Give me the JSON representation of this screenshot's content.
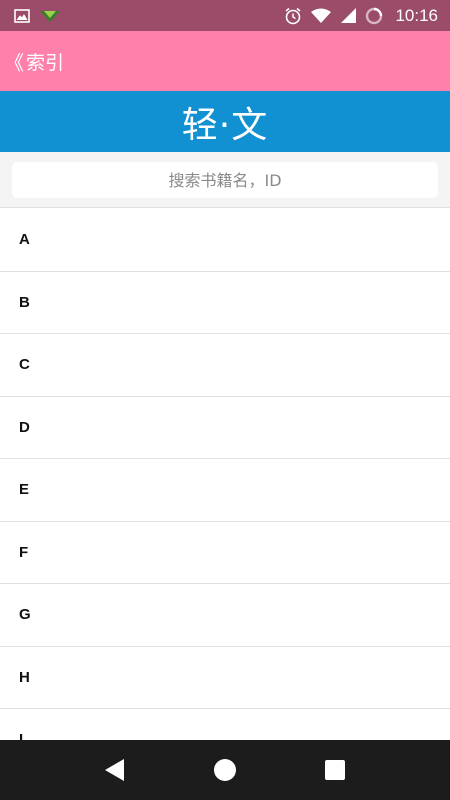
{
  "status_bar": {
    "time": "10:16",
    "icons": [
      "image-icon",
      "download-icon",
      "alarm-icon",
      "wifi-icon",
      "signal-icon",
      "loading-icon"
    ]
  },
  "top_bar": {
    "back_chevron": "《",
    "back_label": "索引"
  },
  "banner": {
    "title": "轻·文"
  },
  "search": {
    "placeholder": "搜索书籍名，ID"
  },
  "index_list": {
    "letters": [
      "A",
      "B",
      "C",
      "D",
      "E",
      "F",
      "G",
      "H",
      "I"
    ]
  },
  "nav_bar": {
    "icons": [
      "back-triangle-icon",
      "home-circle-icon",
      "recents-square-icon"
    ]
  },
  "colors": {
    "status_bar": "#9a4c69",
    "top_bar": "#ff80aa",
    "banner": "#1190d2",
    "nav_bar": "#1c1c1c"
  }
}
